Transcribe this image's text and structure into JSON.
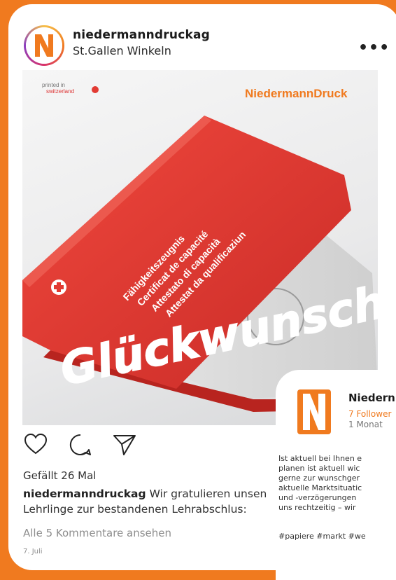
{
  "post": {
    "username": "niedermanndruckag",
    "location": "St.Gallen Winkeln",
    "more_label": "•••",
    "image": {
      "brand_label": "NiedermannDruck",
      "printed_label_line1": "printed in",
      "printed_label_line2": "switzerland",
      "folder_lines": [
        "Fähigkeitszeugnis",
        "Certificat de capacité",
        "Attestato di capacità",
        "Attestat da qualificaziun"
      ],
      "headline": "Glückwunsch"
    },
    "likes": "Gefällt 26 Mal",
    "caption_user": "niedermanndruckag",
    "caption_line1": "Wir gratulieren unsen",
    "caption_line2": "Lehrlinge zur bestandenen Lehrabschlus:",
    "comments_link": "Alle 5 Kommentare ansehen",
    "date": "7. Juli"
  },
  "popup": {
    "name": "Niedern",
    "followers": "7 Follower",
    "time": "1 Monat",
    "body_lines": [
      "Ist aktuell bei Ihnen e",
      "planen ist aktuell wic",
      "gerne zur wunschger",
      "aktuelle Marktsituatic",
      "und -verzögerungen",
      "uns rechtzeitig – wir"
    ],
    "tags": "#papiere #markt #we"
  },
  "colors": {
    "brand_orange": "#f07a1f",
    "folder_red": "#e23b33"
  },
  "icons": [
    "heart-icon",
    "comment-icon",
    "share-icon",
    "more-icon"
  ]
}
